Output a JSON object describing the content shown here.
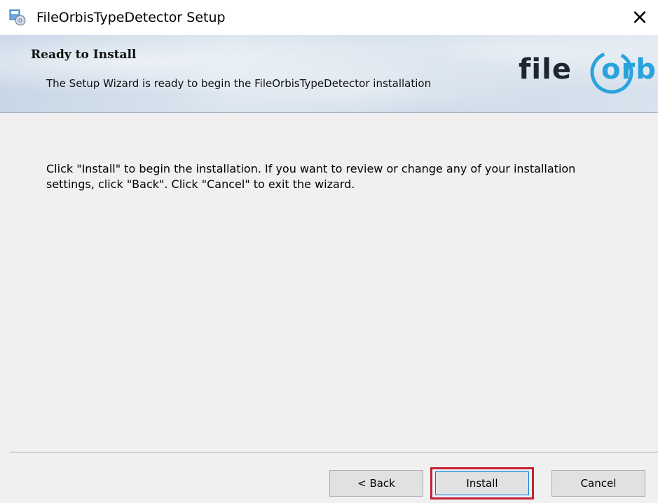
{
  "window": {
    "title": "FileOrbisTypeDetector Setup",
    "close_symbol": "×"
  },
  "banner": {
    "heading": "Ready to Install",
    "subheading": "The Setup Wizard is ready to begin the FileOrbisTypeDetector installation",
    "logo_part1": "file",
    "logo_part2": "orbis",
    "logo_colors": {
      "dark": "#1d2530",
      "accent": "#2aa3dd"
    }
  },
  "body": {
    "instructions": "Click \"Install\" to begin the installation.  If you want to review or change any of your installation settings, click \"Back\".  Click \"Cancel\" to exit the wizard."
  },
  "buttons": {
    "back_label": "< Back",
    "install_label": "Install",
    "cancel_label": "Cancel"
  },
  "colors": {
    "highlight_border": "#c8202e",
    "focus_border": "#0078d7"
  },
  "icons": {
    "app": "installer-icon",
    "close": "close-icon"
  }
}
